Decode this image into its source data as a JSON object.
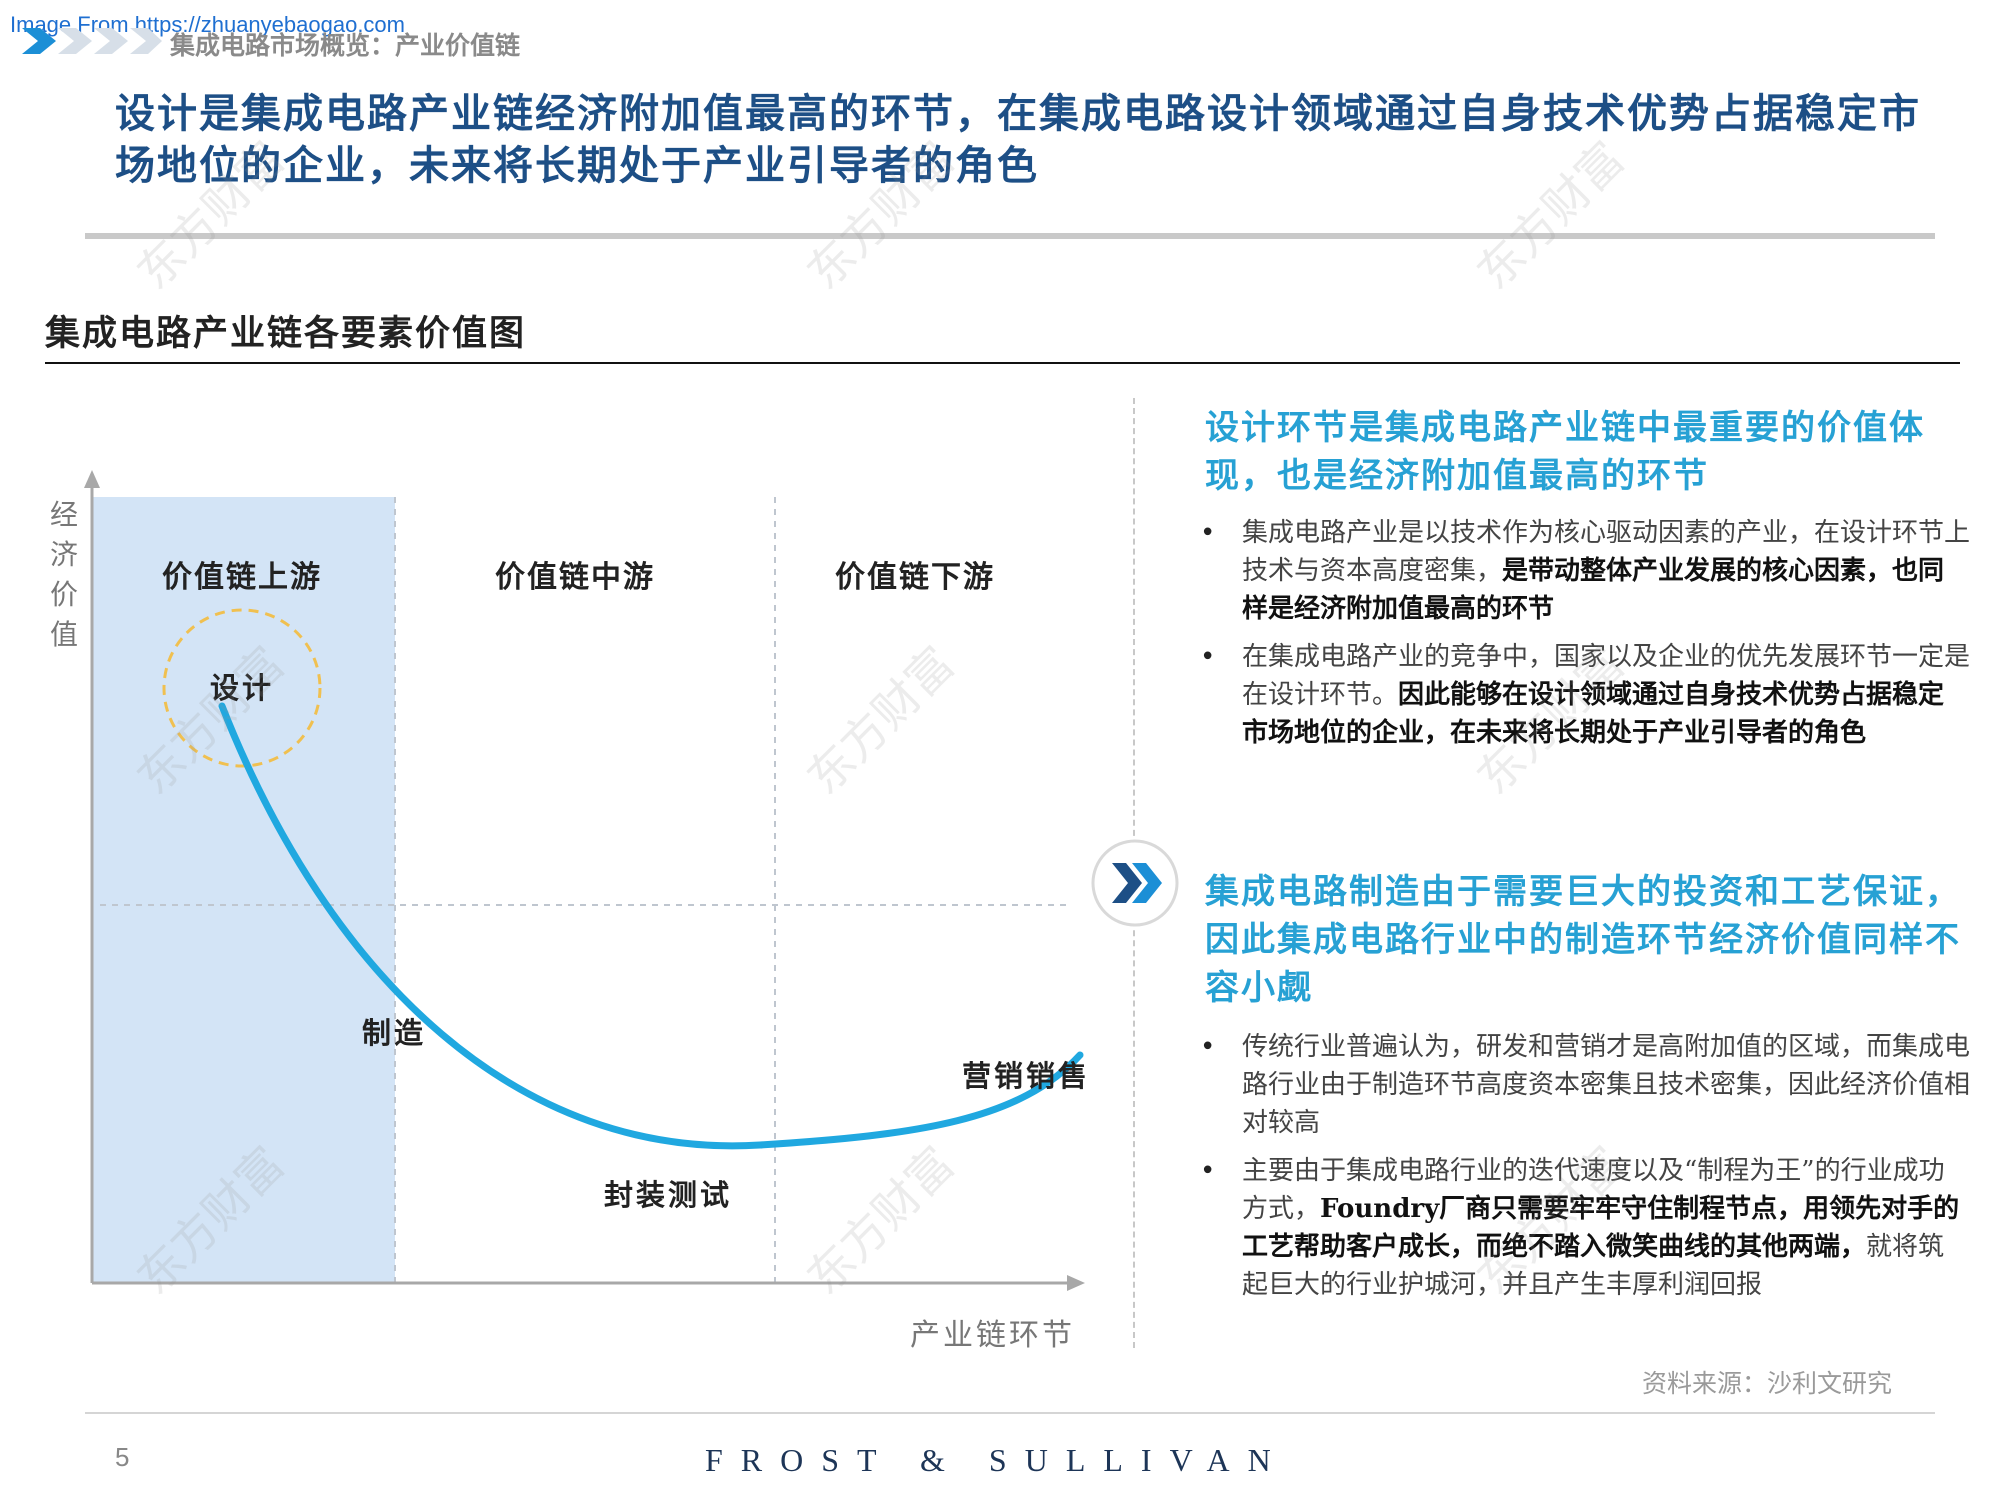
{
  "source_url": "Image From https://zhuanyebaogao.com",
  "breadcrumb": "集成电路市场概览：产业价值链",
  "headline": "设计是集成电路产业链经济附加值最高的环节，在集成电路设计领域通过自身技术优势占据稳定市场地位的企业，未来将长期处于产业引导者的角色",
  "chart_title": "集成电路产业链各要素价值图",
  "chart_data": {
    "type": "diagram",
    "y_axis_label": "经济价值",
    "x_axis_label": "产业链环节",
    "zones": [
      "价值链上游",
      "价值链中游",
      "价值链下游"
    ],
    "points": [
      {
        "label": "设计",
        "value": "高"
      },
      {
        "label": "制造",
        "value": "中"
      },
      {
        "label": "封装测试",
        "value": "低"
      },
      {
        "label": "营销销售",
        "value": "中低"
      }
    ],
    "colors": {
      "curve": "#20a8e0",
      "upstream_fill": "#d3e4f6",
      "highlight_circle": "#f0c050"
    }
  },
  "section1": {
    "heading": "设计环节是集成电路产业链中最重要的价值体现，也是经济附加值最高的环节",
    "bullets": [
      {
        "plain": "集成电路产业是以技术作为核心驱动因素的产业，在设计环节上技术与资本高度密集，",
        "bold": "是带动整体产业发展的核心因素，也同样是经济附加值最高的环节",
        "tail": ""
      },
      {
        "plain": "在集成电路产业的竞争中，国家以及企业的优先发展环节一定是在设计环节。",
        "bold": "因此能够在设计领域通过自身技术优势占据稳定市场地位的企业，在未来将长期处于产业引导者的角色",
        "tail": ""
      }
    ]
  },
  "section2": {
    "heading": "集成电路制造由于需要巨大的投资和工艺保证，因此集成电路行业中的制造环节经济价值同样不容小觑",
    "bullets": [
      {
        "plain": "传统行业普遍认为，研发和营销才是高附加值的区域，而集成电路行业由于制造环节高度资本密集且技术密集，因此经济价值相对较高",
        "bold": "",
        "tail": ""
      },
      {
        "plain": "主要由于集成电路行业的迭代速度以及“制程为王”的行业成功方式，",
        "bold": "Foundry厂商只需要牢牢守住制程节点，用领先对手的工艺帮助客户成长，而绝不踏入微笑曲线的其他两端，",
        "tail": "就将筑起巨大的行业护城河，并且产生丰厚利润回报"
      }
    ]
  },
  "source_note": "资料来源：沙利文研究",
  "page_number": "5",
  "brand": "FROST & SULLIVAN",
  "watermark": "东方财富",
  "arrow_icon": "double-chevron-right-icon"
}
